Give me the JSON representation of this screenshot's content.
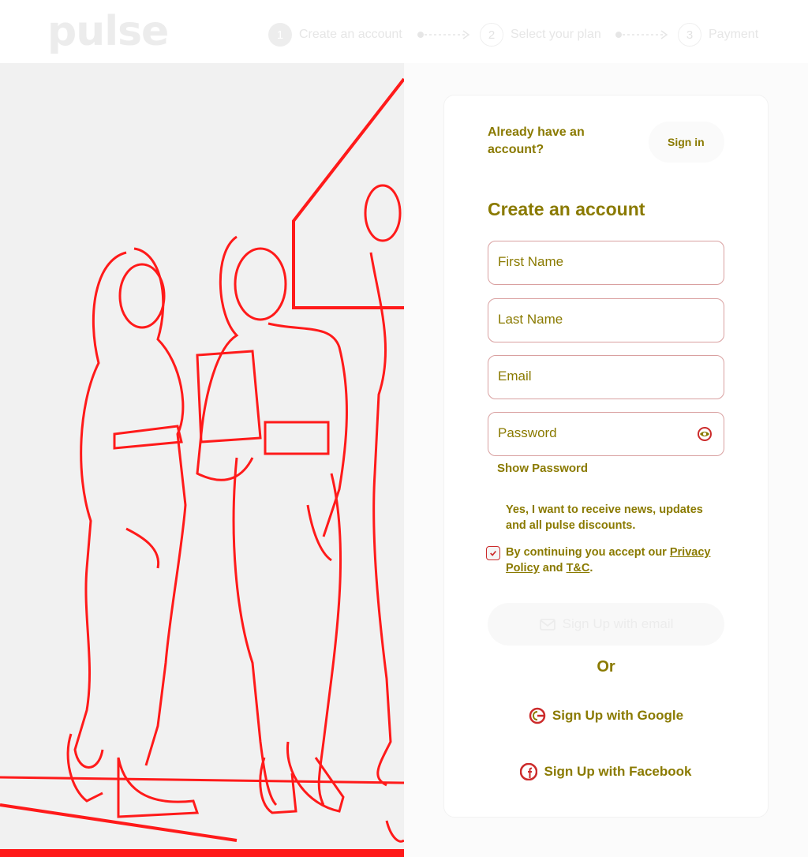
{
  "brand": {
    "logo": "pulse"
  },
  "steps": [
    {
      "number": "1",
      "label": "Create an account"
    },
    {
      "number": "2",
      "label": "Select your plan"
    },
    {
      "number": "3",
      "label": "Payment"
    }
  ],
  "signin_prompt": {
    "text": "Already have an account?",
    "button_label": "Sign in"
  },
  "form": {
    "title": "Create an account",
    "first_name_placeholder": "First Name",
    "last_name_placeholder": "Last Name",
    "email_placeholder": "Email",
    "password_placeholder": "Password",
    "show_password": "Show Password",
    "newsletter_text": "Yes, I want to receive news, updates and all pulse discounts.",
    "terms_prefix": "By continuing you accept our",
    "privacy_link": "Privacy Policy",
    "terms_and": "and",
    "terms_link": "T&C",
    "terms_suffix": ".",
    "email_signup": "Sign Up with email",
    "or": "Or",
    "google_signup": "Sign Up with Google",
    "facebook_signup": "Sign Up with Facebook"
  },
  "colors": {
    "accent_text": "#8a7a00",
    "field_border": "#d9a0a0",
    "checkbox_border": "#cc2b2b"
  },
  "icons": {
    "eye": "eye-icon",
    "mail": "mail-icon",
    "google": "google-icon",
    "facebook": "facebook-icon",
    "check": "check-icon"
  }
}
